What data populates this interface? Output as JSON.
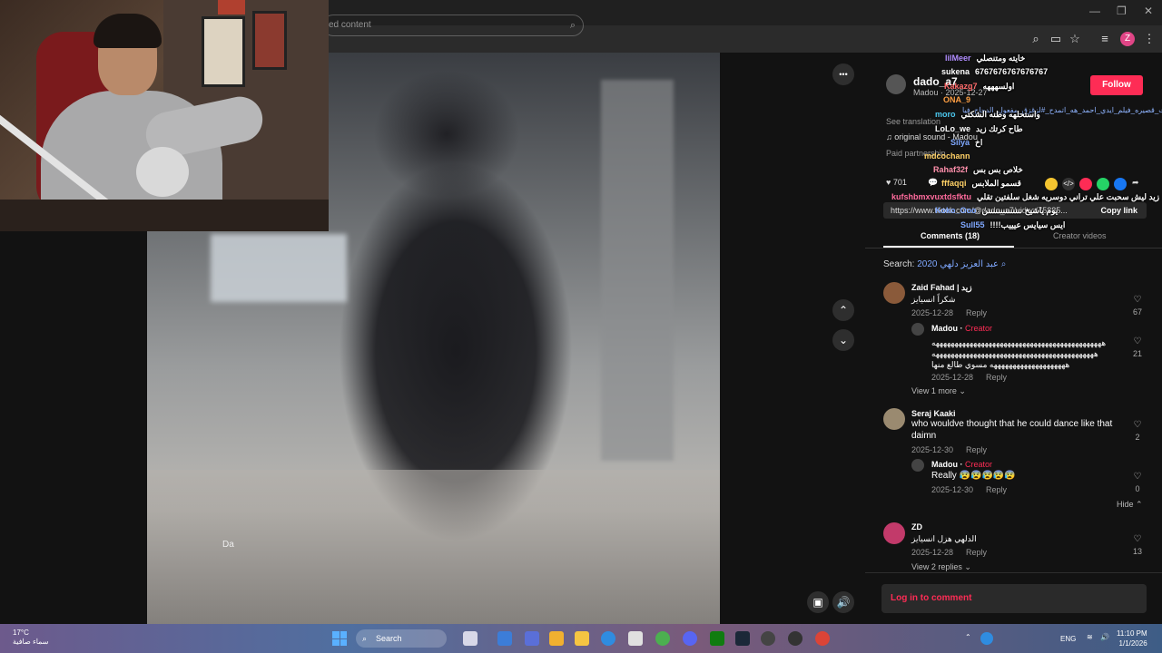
{
  "browser": {
    "window_controls": [
      "—",
      "❐",
      "✕"
    ],
    "toolbar_icons": [
      "zoom-icon",
      "cast-icon",
      "star-icon",
      "media-icon",
      "menu-icon"
    ],
    "profile_initial": "Z"
  },
  "video": {
    "search_placeholder": "ed content",
    "caption": "Da",
    "menu_label": "•••"
  },
  "author": {
    "name": "dado_a7",
    "sub": "Madou · 2025-12-27",
    "follow": "Follow",
    "desc_link": "مالبر_خلق_#هاشتاقات_قصيره_فيلم_ايدي_احمد_هه_اتمدح_#لزقزق_مفعول_الدجاج_فيا",
    "see_translation": "See translation",
    "sound": "original sound - Madou",
    "paid": "Paid partnership",
    "likes": "701",
    "copy_url": "https://www.tiktok.com/@dado_a7/video/75885...",
    "copy_link": "Copy link"
  },
  "tabs": {
    "comments": "Comments (18)",
    "creator_videos": "Creator videos"
  },
  "search": {
    "label": "Search:",
    "query": "عبد العزيز دلهي 2020"
  },
  "comments": [
    {
      "user": "Zaid Fahad | زيد",
      "text": "شكراً انسيايز",
      "date": "2025-12-28",
      "reply": "Reply",
      "likes": "67"
    },
    {
      "user": "Madou",
      "creator": "Creator",
      "text1": "هههههههههههههههههههههههههههههههههههههههههههههه",
      "text2": "هههههههههههههههههههههههههههههههههههههههههههه",
      "text3": "ههههههههههههههههههههه مسوي طالع منها",
      "date": "2025-12-28",
      "reply": "Reply",
      "likes": "21"
    },
    {
      "view_more": "View 1 more"
    },
    {
      "user": "Seraj Kaaki",
      "text1": "who wouldve thought that he could dance like that",
      "text2": "daimn",
      "date": "2025-12-30",
      "reply": "Reply",
      "likes": "2"
    },
    {
      "user": "Madou",
      "creator": "Creator",
      "text": "Really 😰😰😰😰😰",
      "date": "2025-12-30",
      "reply": "Reply",
      "likes": "0"
    },
    {
      "hide": "Hide"
    },
    {
      "user": "ZD",
      "text": "الدلهي هزل انسيايز",
      "date": "2025-12-28",
      "reply": "Reply",
      "likes": "13",
      "view_replies": "View 2 replies"
    }
  ],
  "login": "Log in to comment",
  "chat": [
    {
      "user": "lilMeer",
      "msg": "خايته ومتنصلي",
      "color": "#b08cff"
    },
    {
      "user": "sukena",
      "msg": "6767676767676767",
      "color": "#ffffff"
    },
    {
      "user": "Kakazg7",
      "msg": "اولسهههه",
      "color": "#ff6b6b"
    },
    {
      "user": "ONA_9",
      "msg": "",
      "color": "#ff9f43"
    },
    {
      "user": "moro",
      "msg": "واستحلهه وطنه الشكتي",
      "color": "#4cc9f0"
    },
    {
      "user": "LoLo_we",
      "msg": "طاح كرتك زيد",
      "color": "#ffffff"
    },
    {
      "user": "Silya",
      "msg": "اخ",
      "color": "#7fa8ff"
    },
    {
      "user": "mdcochann",
      "msg": "",
      "color": "#ffd166"
    },
    {
      "user": "Rahaf32f",
      "msg": "خلاص بس بس",
      "color": "#ff8fab"
    },
    {
      "user": "fffaqqi",
      "msg": "قسمو الملابس",
      "color": "#ffd166"
    },
    {
      "user": "kufshbmxvuxtdsfktu",
      "msg": "زيد ليش سحبت علي تراني دوسريه شغل سلفتين تقلي",
      "color": "#ff6b9d"
    },
    {
      "user": "Koko_Ooo",
      "msg": "يوم ياشيخ ننننننننننننننن",
      "color": "#7fa8ff"
    },
    {
      "user": "Sull55",
      "msg": "!!!!ايس سيايس عيييب",
      "color": "#7fa8ff"
    }
  ],
  "taskbar": {
    "weather_temp": "17°C",
    "weather_desc": "سماء صافية",
    "search": "Search",
    "lang": "ENG",
    "time": "11:10 PM",
    "date": "1/1/2026"
  }
}
